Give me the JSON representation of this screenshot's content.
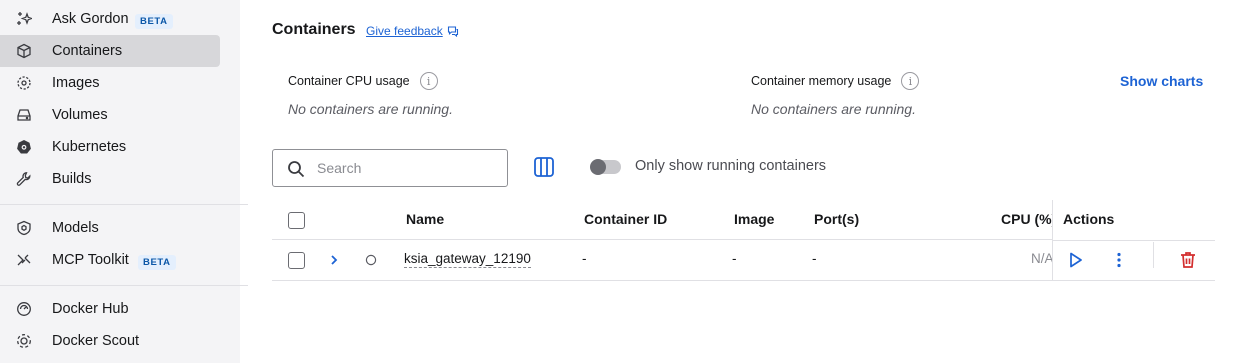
{
  "sidebar": {
    "items": [
      {
        "label": "Ask Gordon",
        "icon": "sparkle-icon",
        "badge": "BETA"
      },
      {
        "label": "Containers",
        "icon": "container-icon",
        "active": true
      },
      {
        "label": "Images",
        "icon": "image-icon"
      },
      {
        "label": "Volumes",
        "icon": "volume-icon"
      },
      {
        "label": "Kubernetes",
        "icon": "kubernetes-icon"
      },
      {
        "label": "Builds",
        "icon": "wrench-icon"
      },
      {
        "label": "Models",
        "icon": "model-icon"
      },
      {
        "label": "MCP Toolkit",
        "icon": "toolkit-icon",
        "badge": "BETA"
      },
      {
        "label": "Docker Hub",
        "icon": "hub-icon"
      },
      {
        "label": "Docker Scout",
        "icon": "scout-icon"
      }
    ]
  },
  "header": {
    "title": "Containers",
    "feedback_label": "Give feedback"
  },
  "stats": {
    "cpu_label": "Container CPU usage",
    "cpu_empty": "No containers are running.",
    "memory_label": "Container memory usage",
    "memory_empty": "No containers are running.",
    "show_charts": "Show charts"
  },
  "toolbar": {
    "search_placeholder": "Search",
    "toggle_label": "Only show running containers",
    "toggle_on": false
  },
  "table": {
    "headers": {
      "name": "Name",
      "container_id": "Container ID",
      "image": "Image",
      "ports": "Port(s)",
      "cpu": "CPU (%)",
      "actions": "Actions"
    },
    "rows": [
      {
        "name": "ksia_gateway_12190",
        "container_id": "-",
        "image": "-",
        "ports": "-",
        "cpu": "N/A",
        "status": "stopped"
      }
    ]
  },
  "colors": {
    "accent": "#1d63d4",
    "delete": "#d32f2f",
    "sidebar_bg": "#f4f4f6",
    "active_bg": "#d7d7da"
  }
}
